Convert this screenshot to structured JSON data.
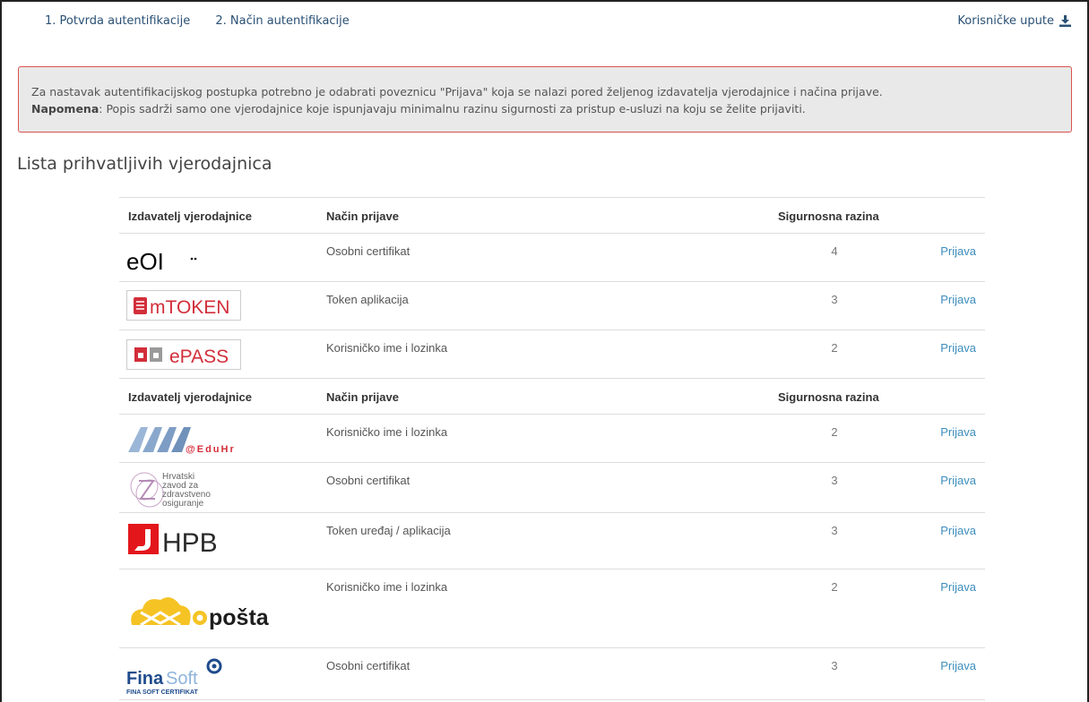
{
  "nav": {
    "step1": "1. Potvrda autentifikacije",
    "step2": "2. Način autentifikacije",
    "help": "Korisničke upute"
  },
  "alert": {
    "line1": "Za nastavak autentifikacijskog postupka potrebno je odabrati poveznicu \"Prijava\" koja se nalazi pored željenog izdavatelja vjerodajnice i načina prijave.",
    "note_label": "Napomena",
    "note_text": ": Popis sadrži samo one vjerodajnice koje ispunjavaju minimalnu razinu sigurnosti za pristup e-usluzi na koju se želite prijaviti."
  },
  "section_title": "Lista prihvatljivih vjerodajnica",
  "table": {
    "headers": [
      "Izdavatelj vjerodajnice",
      "Način prijave",
      "Sigurnosna razina"
    ],
    "group1": [
      {
        "issuer": "eOI",
        "method": "Osobni certifikat",
        "level": "4",
        "action": "Prijava"
      },
      {
        "issuer": "mTOKEN",
        "method": "Token aplikacija",
        "level": "3",
        "action": "Prijava"
      },
      {
        "issuer": "ePASS",
        "method": "Korisničko ime i lozinka",
        "level": "2",
        "action": "Prijava"
      }
    ],
    "group2": [
      {
        "issuer": "@EduHr",
        "method": "Korisničko ime i lozinka",
        "level": "2",
        "action": "Prijava"
      },
      {
        "issuer_lines": [
          "Hrvatski",
          "zavod za",
          "zdravstveno",
          "osiguranje"
        ],
        "method": "Osobni certifikat",
        "level": "3",
        "action": "Prijava"
      },
      {
        "issuer": "HPB",
        "method": "Token uređaj / aplikacija",
        "level": "3",
        "action": "Prijava"
      },
      {
        "issuer": "pošta",
        "method": "Korisničko ime i lozinka",
        "level": "2",
        "action": "Prijava"
      },
      {
        "issuer": "Fina",
        "issuer2": "Soft",
        "issuer_sub": "FINA SOFT CERTIFIKAT",
        "method": "Osobni certifikat",
        "level": "3",
        "action": "Prijava"
      }
    ]
  },
  "colors": {
    "link": "#3c8dbc",
    "alert_border": "#d9534f",
    "hpb_red": "#e3161b",
    "eposta_yellow": "#f5c324"
  }
}
